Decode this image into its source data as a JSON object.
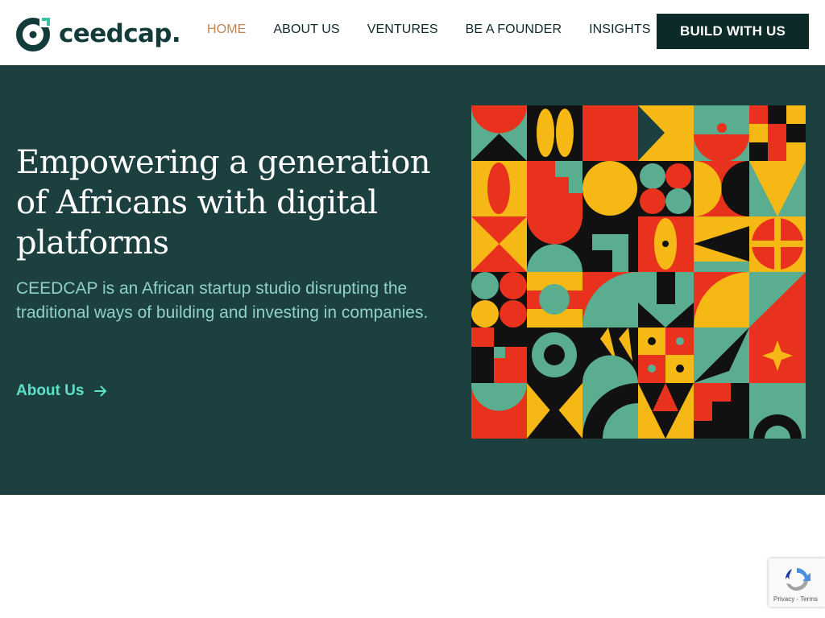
{
  "brand": {
    "name": "ceedcap.",
    "colors": {
      "primary": "#123b3a",
      "accent": "#5ee0c8",
      "active_nav": "#c0845a"
    }
  },
  "nav": {
    "items": [
      {
        "label": "HOME",
        "active": true
      },
      {
        "label": "ABOUT US",
        "active": false
      },
      {
        "label": "VENTURES",
        "active": false
      },
      {
        "label": "BE A FOUNDER",
        "active": false
      },
      {
        "label": "INSIGHTS",
        "active": false
      }
    ],
    "cta_label": "BUILD WITH US"
  },
  "hero": {
    "title": "Empowering a generation of Africans with digital platforms",
    "subtitle": "CEEDCAP is an African startup studio disrupting the traditional ways of building and investing in companies.",
    "link_label": "About Us",
    "link_icon": "arrow-right-icon",
    "artwork": "geometric-african-pattern-image"
  },
  "recaptcha": {
    "privacy": "Privacy",
    "separator": "-",
    "terms": "Terms"
  }
}
